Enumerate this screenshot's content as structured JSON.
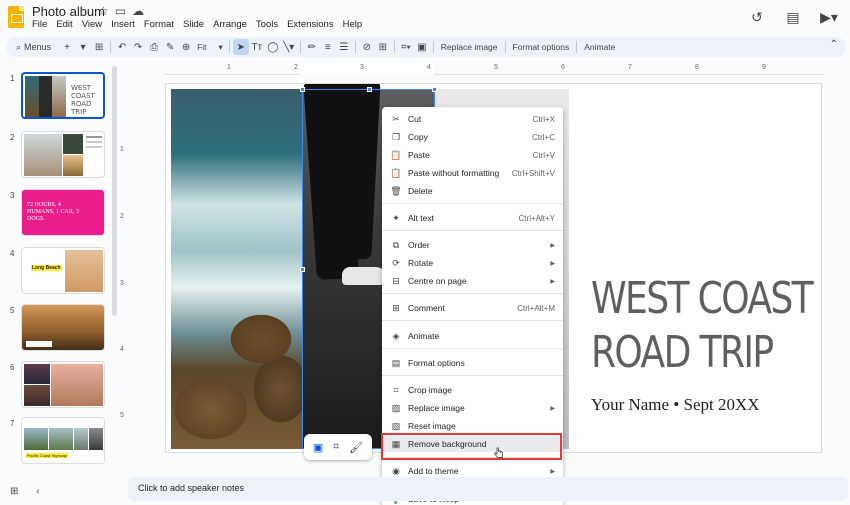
{
  "app": {
    "doc_title": "Photo album",
    "menu": [
      "File",
      "Edit",
      "View",
      "Insert",
      "Format",
      "Slide",
      "Arrange",
      "Tools",
      "Extensions",
      "Help"
    ]
  },
  "toolbar": {
    "search_label": "Menus",
    "zoom_label": "Fit",
    "replace_image_label": "Replace image",
    "format_options_label": "Format options",
    "animate_label": "Animate"
  },
  "filmstrip": {
    "slides": [
      {
        "number": "1"
      },
      {
        "number": "2"
      },
      {
        "number": "3",
        "text": "72 HOURS, 4 HUMANS, 1 CAR, 3 DOGS."
      },
      {
        "number": "4",
        "text": "Long Beach"
      },
      {
        "number": "5"
      },
      {
        "number": "6"
      },
      {
        "number": "7",
        "text": "Pacific Coast Highway"
      }
    ]
  },
  "ruler": {
    "h_numbers": [
      "1",
      "2",
      "3",
      "4",
      "5",
      "6",
      "7",
      "8",
      "9"
    ],
    "v_numbers": [
      "1",
      "2",
      "3",
      "4",
      "5"
    ]
  },
  "slide": {
    "title": "WEST COAST ROAD TRIP",
    "title_line1": "WEST COAST",
    "title_line2": "ROAD TRIP",
    "subtitle": "Your Name • Sept 20XX"
  },
  "context_menu": {
    "items": [
      {
        "label": "Cut",
        "shortcut": "Ctrl+X",
        "icon": "scissors-icon"
      },
      {
        "label": "Copy",
        "shortcut": "Ctrl+C",
        "icon": "copy-icon"
      },
      {
        "label": "Paste",
        "shortcut": "Ctrl+V",
        "icon": "paste-icon"
      },
      {
        "label": "Paste without formatting",
        "shortcut": "Ctrl+Shift+V",
        "icon": "paste-plain-icon"
      },
      {
        "label": "Delete",
        "shortcut": "",
        "icon": "trash-icon"
      },
      {
        "label": "Alt text",
        "shortcut": "Ctrl+Alt+Y",
        "icon": "accessibility-icon"
      },
      {
        "label": "Order",
        "shortcut": "",
        "icon": "order-icon"
      },
      {
        "label": "Rotate",
        "shortcut": "",
        "icon": "rotate-icon"
      },
      {
        "label": "Centre on page",
        "shortcut": "",
        "icon": "center-icon"
      },
      {
        "label": "Comment",
        "shortcut": "Ctrl+Alt+M",
        "icon": "comment-icon"
      },
      {
        "label": "Animate",
        "shortcut": "",
        "icon": "animate-icon"
      },
      {
        "label": "Format options",
        "shortcut": "",
        "icon": "format-options-icon"
      },
      {
        "label": "Crop image",
        "shortcut": "",
        "icon": "crop-icon"
      },
      {
        "label": "Replace image",
        "shortcut": "",
        "icon": "replace-image-icon"
      },
      {
        "label": "Reset image",
        "shortcut": "",
        "icon": "reset-image-icon"
      },
      {
        "label": "Remove background",
        "shortcut": "",
        "icon": "remove-background-icon"
      },
      {
        "label": "Add to theme",
        "shortcut": "",
        "icon": "theme-icon"
      },
      {
        "label": "Save to Keep",
        "shortcut": "",
        "icon": "keep-icon"
      }
    ]
  },
  "notes": {
    "placeholder": "Click to add speaker notes"
  },
  "colors": {
    "accent": "#0b57d0",
    "highlight_border": "#e53935",
    "toolbar_bg": "#edf2fa"
  }
}
